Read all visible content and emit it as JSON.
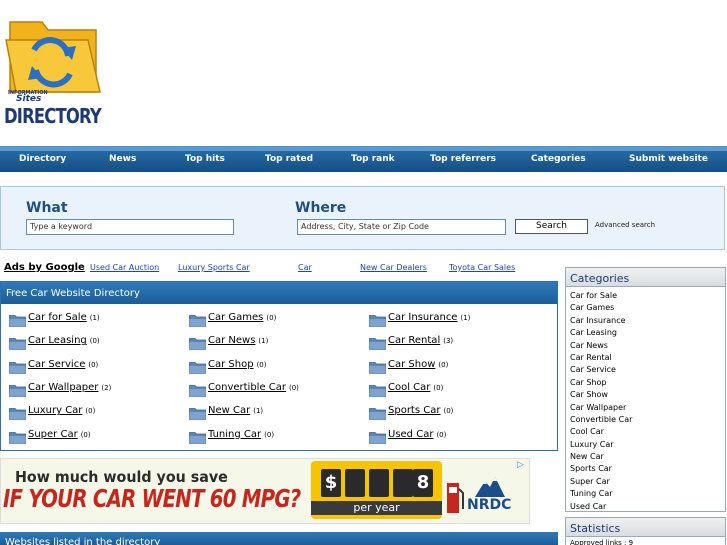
{
  "logo": {
    "small_text": "INFORMATION",
    "sites": "Sites",
    "word": "DIRECTORY"
  },
  "nav": [
    {
      "label": "Directory"
    },
    {
      "label": "News"
    },
    {
      "label": "Top hits"
    },
    {
      "label": "Top rated"
    },
    {
      "label": "Top rank"
    },
    {
      "label": "Top referrers"
    },
    {
      "label": "Categories"
    },
    {
      "label": "Submit website"
    }
  ],
  "search": {
    "what_label": "What",
    "where_label": "Where",
    "what_placeholder": "Type a keyword",
    "where_placeholder": "Address, City, State or Zip Code",
    "button": "Search",
    "advanced": "Advanced search"
  },
  "ads": {
    "label": "Ads by Google",
    "links": [
      "Used Car Auction",
      "Luxury Sports Car",
      "Car",
      "New Car Dealers",
      "Toyota Car Sales"
    ]
  },
  "directory": {
    "title": "Free Car Website Directory",
    "categories": [
      {
        "name": "Car for Sale",
        "count": "(1)"
      },
      {
        "name": "Car Games",
        "count": "(0)"
      },
      {
        "name": "Car Insurance",
        "count": "(1)"
      },
      {
        "name": "Car Leasing",
        "count": "(0)"
      },
      {
        "name": "Car News",
        "count": "(1)"
      },
      {
        "name": "Car Rental",
        "count": "(3)"
      },
      {
        "name": "Car Service",
        "count": "(0)"
      },
      {
        "name": "Car Shop",
        "count": "(0)"
      },
      {
        "name": "Car Show",
        "count": "(0)"
      },
      {
        "name": "Car Wallpaper",
        "count": "(2)"
      },
      {
        "name": "Convertible Car",
        "count": "(0)"
      },
      {
        "name": "Cool Car",
        "count": "(0)"
      },
      {
        "name": "Luxury Car",
        "count": "(0)"
      },
      {
        "name": "New Car",
        "count": "(1)"
      },
      {
        "name": "Sports Car",
        "count": "(0)"
      },
      {
        "name": "Super Car",
        "count": "(0)"
      },
      {
        "name": "Tuning Car",
        "count": "(0)"
      },
      {
        "name": "Used Car",
        "count": "(0)"
      }
    ]
  },
  "banner": {
    "line1": "How much would you save",
    "line2": "IF YOUR CAR WENT 60 MPG?",
    "dollar": "$",
    "digit": "8",
    "per_year": "per year",
    "brand": "NRDC",
    "colors": {
      "headline": "#c5261e",
      "gauge": "#f6c400"
    }
  },
  "listed": {
    "title": "Websites listed in the directory"
  },
  "sidebar": {
    "categories_title": "Categories",
    "categories": [
      "Car for Sale",
      "Car Games",
      "Car Insurance",
      "Car Leasing",
      "Car News",
      "Car Rental",
      "Car Service",
      "Car Shop",
      "Car Show",
      "Car Wallpaper",
      "Convertible Car",
      "Cool Car",
      "Luxury Car",
      "New Car",
      "Sports Car",
      "Super Car",
      "Tuning Car",
      "Used Car"
    ],
    "stats_title": "Statistics",
    "stats": [
      "Approved links : 9"
    ]
  },
  "colors": {
    "nav": "#1b5d99",
    "accent": "#1f4f86",
    "link": "#1a44c2"
  }
}
